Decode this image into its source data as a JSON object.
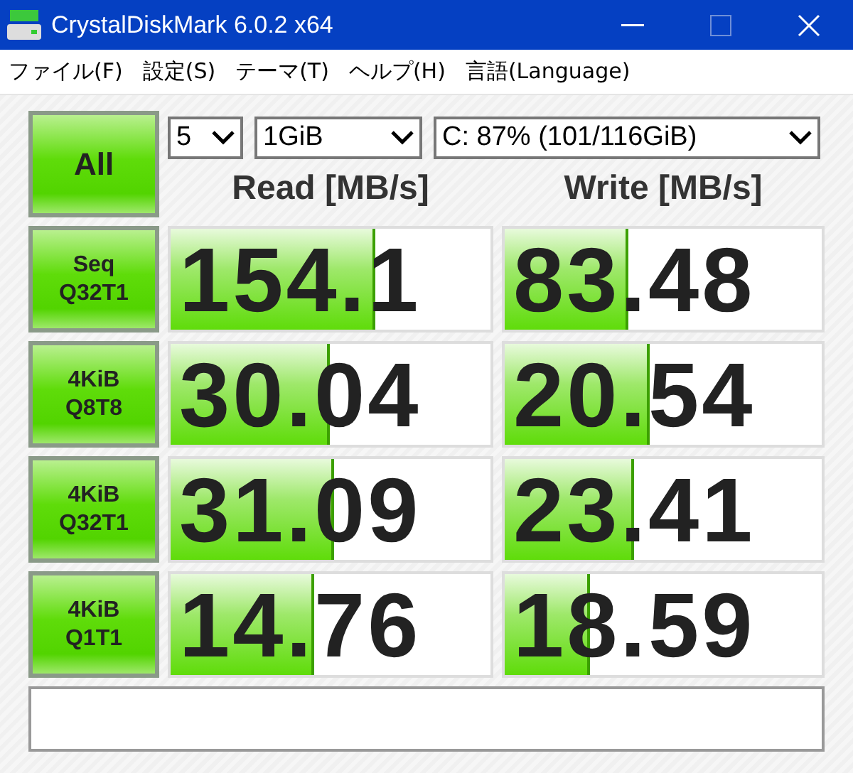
{
  "window": {
    "title": "CrystalDiskMark 6.0.2 x64"
  },
  "menu": [
    "ファイル(F)",
    "設定(S)",
    "テーマ(T)",
    "ヘルプ(H)",
    "言語(Language)"
  ],
  "all_button": "All",
  "selects": [
    {
      "value": "5"
    },
    {
      "value": "1GiB"
    },
    {
      "value": "C: 87% (101/116GiB)"
    }
  ],
  "headers": [
    "Read [MB/s]",
    "Write [MB/s]"
  ],
  "rows": [
    {
      "label": [
        "Seq",
        "Q32T1"
      ],
      "read": {
        "value": "154.1",
        "level": 0.63
      },
      "write": {
        "value": "83.48",
        "level": 0.38
      }
    },
    {
      "label": [
        "4KiB",
        "Q8T8"
      ],
      "read": {
        "value": "30.04",
        "level": 0.49
      },
      "write": {
        "value": "20.54",
        "level": 0.45
      }
    },
    {
      "label": [
        "4KiB",
        "Q32T1"
      ],
      "read": {
        "value": "31.09",
        "level": 0.5
      },
      "write": {
        "value": "23.41",
        "level": 0.4
      }
    },
    {
      "label": [
        "4KiB",
        "Q1T1"
      ],
      "read": {
        "value": "14.76",
        "level": 0.44
      },
      "write": {
        "value": "18.59",
        "level": 0.26
      }
    }
  ]
}
